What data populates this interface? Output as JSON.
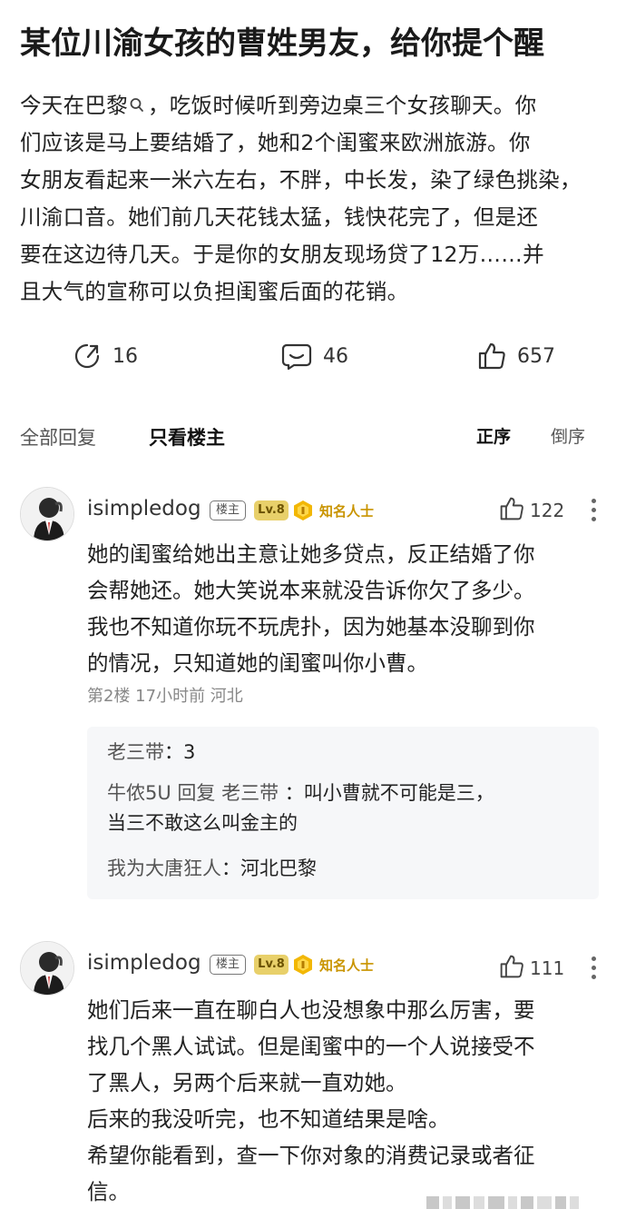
{
  "post": {
    "title": "某位川渝女孩的曹姓男友，给你提个醒",
    "body_lines": [
      "今天在巴黎",
      "，吃饭时候听到旁边桌三个女孩聊天。你",
      "们应该是马上要结婚了，她和2个闺蜜来欧洲旅游。你",
      "女朋友看起来一米六左右，不胖，中长发，染了绿色挑染，",
      "川渝口音。她们前几天花钱太猛，钱快花完了，但是还",
      "要在这边待几天。于是你的女朋友现场贷了12万……并",
      "且大气的宣称可以负担闺蜜后面的花销。"
    ],
    "actions": {
      "share_count": "16",
      "comment_count": "46",
      "like_count": "657"
    }
  },
  "filter": {
    "all_replies": "全部回复",
    "op_only": "只看楼主",
    "sort_asc": "正序",
    "sort_desc": "倒序"
  },
  "comments": [
    {
      "username": "isimpledog",
      "op_tag": "楼主",
      "level": "Lv.8",
      "fame": "知名人士",
      "likes": "122",
      "lines": [
        "她的闺蜜给她出主意让她多贷点，反正结婚了你",
        "会帮她还。她大笑说本来就没告诉你欠了多少。",
        "我也不知道你玩不玩虎扑，因为她基本没聊到你",
        "的情况，只知道她的闺蜜叫你小曹。"
      ],
      "meta": "第2楼  17小时前  河北",
      "replies": [
        {
          "who": "老三带",
          "text": "：3"
        },
        {
          "who": "牛侬5U 回复 老三带 ",
          "text": "：叫小曹就不可能是三，",
          "text2": "当三不敢这么叫金主的"
        },
        {
          "who": "我为大唐狂人",
          "text": "：河北巴黎"
        }
      ]
    },
    {
      "username": "isimpledog",
      "op_tag": "楼主",
      "level": "Lv.8",
      "fame": "知名人士",
      "likes": "111",
      "lines": [
        "她们后来一直在聊白人也没想象中那么厉害，要",
        "找几个黑人试试。但是闺蜜中的一个人说接受不",
        "了黑人，另两个后来就一直劝她。",
        "后来的我没听完，也不知道结果是啥。",
        "希望你能看到，查一下你对象的消费记录或者征",
        "信。"
      ]
    }
  ],
  "icons": {
    "search": "search-icon",
    "share": "share-icon",
    "comment": "comment-icon",
    "like": "thumbs-up-icon",
    "more": "more-icon",
    "medal": "medal-icon"
  }
}
